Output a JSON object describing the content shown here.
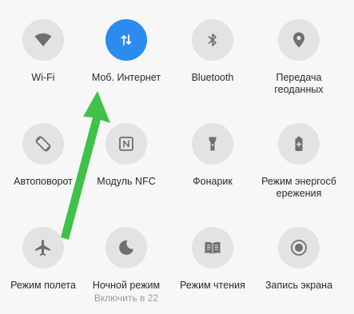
{
  "tiles": [
    {
      "label": "Wi-Fi",
      "icon": "wifi-icon",
      "active": false
    },
    {
      "label": "Моб. Интернет",
      "icon": "mobile-data-icon",
      "active": true
    },
    {
      "label": "Bluetooth",
      "icon": "bluetooth-icon",
      "active": false
    },
    {
      "label": "Передача\nгеоданных",
      "icon": "location-icon",
      "active": false
    },
    {
      "label": "Автоповорот",
      "icon": "auto-rotate-icon",
      "active": false
    },
    {
      "label": "Модуль NFC",
      "icon": "nfc-icon",
      "active": false
    },
    {
      "label": "Фонарик",
      "icon": "flashlight-icon",
      "active": false
    },
    {
      "label": "Режим энергосб\nережения",
      "icon": "battery-saver-icon",
      "active": false
    },
    {
      "label": "Режим полета",
      "icon": "airplane-icon",
      "active": false
    },
    {
      "label": "Ночной режим",
      "sublabel": "Включить в 22",
      "icon": "night-mode-icon",
      "active": false
    },
    {
      "label": "Режим чтения",
      "icon": "reading-mode-icon",
      "active": false
    },
    {
      "label": "Запись экрана",
      "icon": "screen-record-icon",
      "active": false
    }
  ],
  "colors": {
    "accent": "#2b8bef",
    "tile_bg": "#e3e3e3",
    "icon": "#6f6f6f",
    "arrow": "#3fc14a"
  }
}
